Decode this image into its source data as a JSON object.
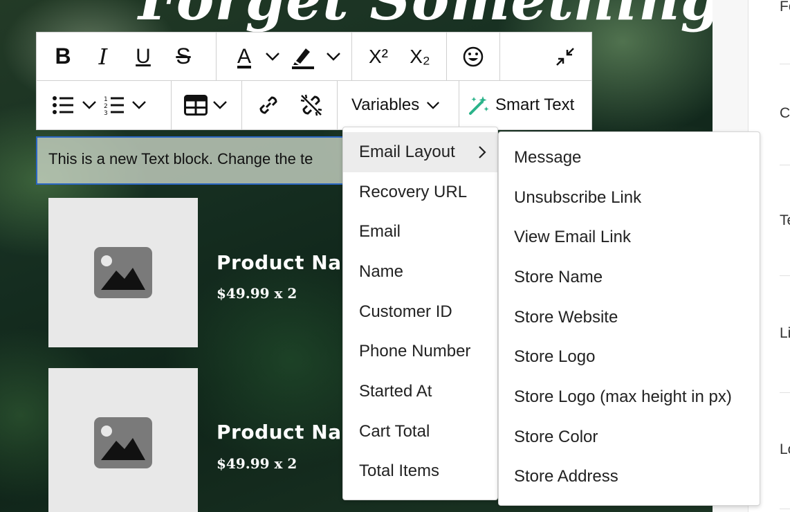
{
  "headline": "Forget Something?",
  "toolbar": {
    "bold_label": "B",
    "italic_label": "I",
    "underline_label": "U",
    "strike_label": "S",
    "font_color_label": "A",
    "superscript_label": "X²",
    "subscript_label": "X₂",
    "variables_label": "Variables",
    "smart_text_label": "Smart Text",
    "icons": [
      "bold-icon",
      "italic-icon",
      "underline-icon",
      "strikethrough-icon",
      "font-color-icon",
      "highlight-icon",
      "superscript-icon",
      "subscript-icon",
      "emoji-icon",
      "collapse-icon",
      "bullet-list-icon",
      "numbered-list-icon",
      "table-icon",
      "link-icon",
      "unlink-icon",
      "chevron-down-icon",
      "magic-wand-icon"
    ],
    "accent_colors": {
      "underline_bar": "#111111",
      "wand": "#2bb38a"
    }
  },
  "text_block": {
    "content": "This is a new Text block. Change the te"
  },
  "products": [
    {
      "name": "Product Na",
      "price": "$49.99 x 2"
    },
    {
      "name": "Product Na",
      "price": "$49.99 x 2"
    }
  ],
  "variables_menu": {
    "items": [
      {
        "label": "Email Layout"
      },
      {
        "label": "Recovery URL"
      },
      {
        "label": "Email"
      },
      {
        "label": "Name"
      },
      {
        "label": "Customer ID"
      },
      {
        "label": "Phone Number"
      },
      {
        "label": "Started At"
      },
      {
        "label": "Cart Total"
      },
      {
        "label": "Total Items"
      }
    ]
  },
  "submenu": {
    "items": [
      {
        "label": "Message"
      },
      {
        "label": "Unsubscribe Link"
      },
      {
        "label": "View Email Link"
      },
      {
        "label": "Store Name"
      },
      {
        "label": "Store Website"
      },
      {
        "label": "Store Logo"
      },
      {
        "label": "Store Logo (max height in px)"
      },
      {
        "label": "Store Color"
      },
      {
        "label": "Store Address"
      }
    ]
  },
  "right_panel": {
    "labels": [
      "Fo",
      "C",
      "Te",
      "Li",
      "Lo"
    ]
  },
  "colors": {
    "selection_border": "#2a66c4",
    "menu_hover": "#ececec",
    "placeholder_bg": "#e8e8e8",
    "placeholder_icon": "#7a7a7a"
  }
}
